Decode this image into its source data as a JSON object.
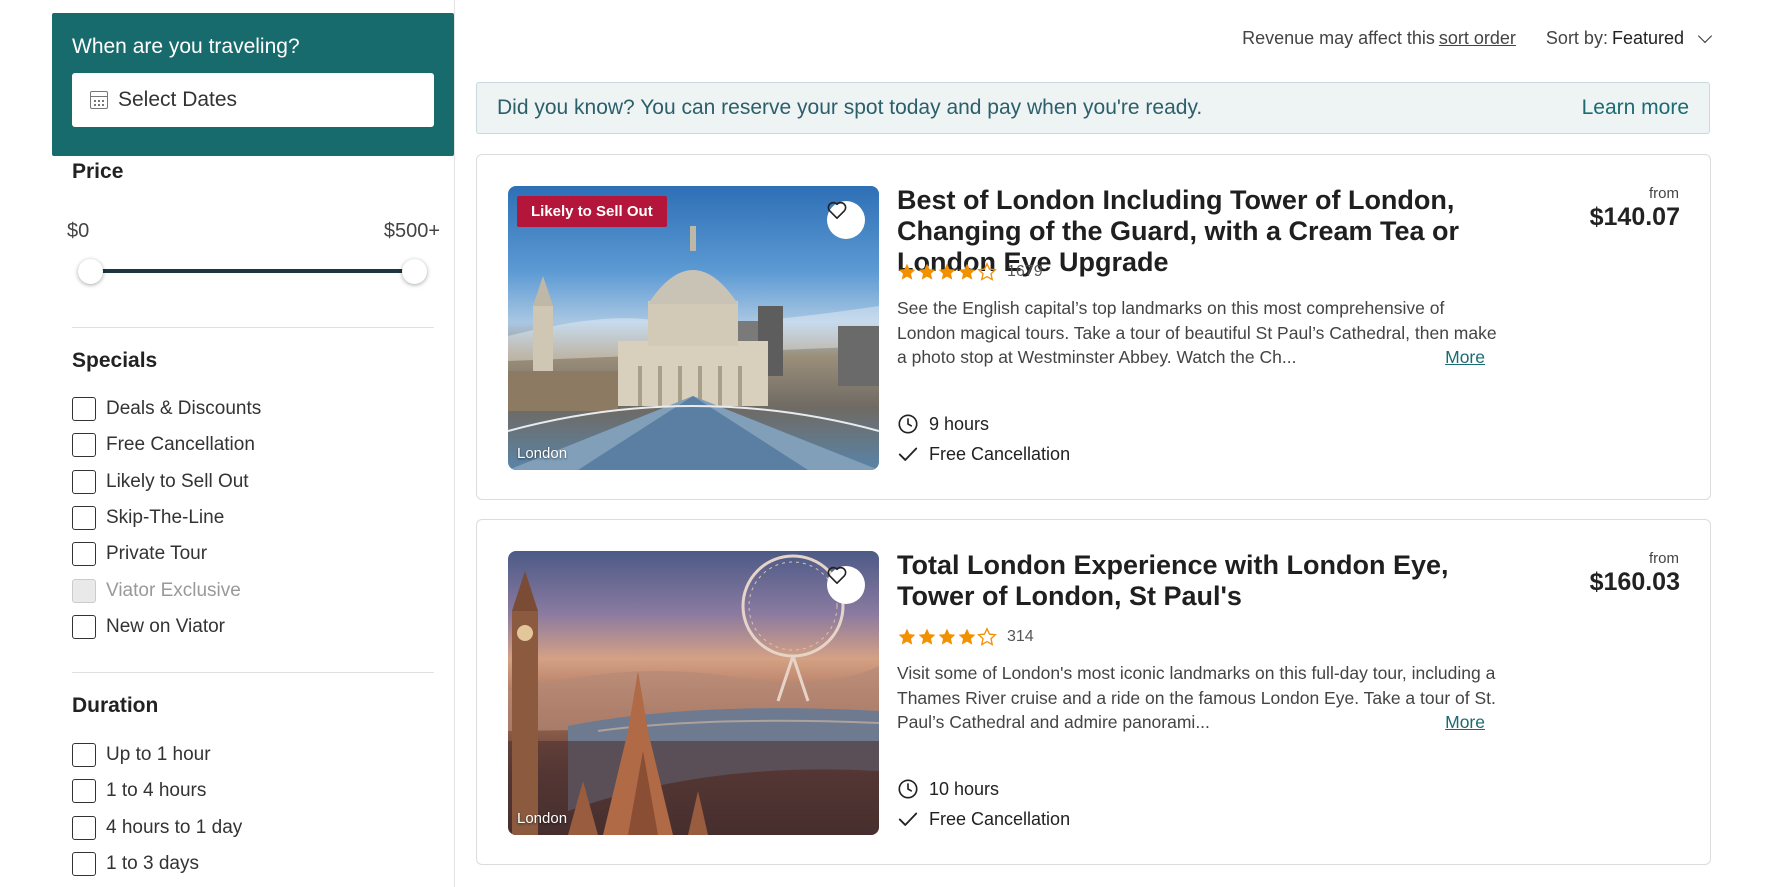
{
  "sidebar": {
    "dates": {
      "title": "When are you traveling?",
      "button_label": "Select Dates"
    },
    "price": {
      "title": "Price",
      "min_label": "$0",
      "max_label": "$500+"
    },
    "specials": {
      "title": "Specials",
      "items": [
        "Deals & Discounts",
        "Free Cancellation",
        "Likely to Sell Out",
        "Skip-The-Line",
        "Private Tour",
        "Viator Exclusive",
        "New on Viator"
      ]
    },
    "duration": {
      "title": "Duration",
      "items": [
        "Up to 1 hour",
        "1 to 4 hours",
        "4 hours to 1 day",
        "1 to 3 days"
      ]
    }
  },
  "topbar": {
    "revenue_text": "Revenue may affect this",
    "sort_order_link": "sort order",
    "sort_label": "Sort by:",
    "sort_value": "Featured"
  },
  "banner": {
    "message": "Did you know?  You can reserve your spot today and pay when you're ready.",
    "link": "Learn more"
  },
  "results": [
    {
      "badge": "Likely to Sell Out",
      "location": "London",
      "title": "Best of London Including Tower of London, Changing of the Guard, with a Cream Tea or London Eye Upgrade",
      "rating": 4,
      "review_count": "1679",
      "description": "See the English capital’s top landmarks on this most comprehensive of London magical tours. Take a tour of beautiful St Paul’s Cathedral, then make a photo stop at Westminster Abbey. Watch the Ch...",
      "more": "More",
      "duration": "9 hours",
      "cancellation": "Free Cancellation",
      "from_label": "from",
      "price": "$140.07"
    },
    {
      "location": "London",
      "title": "Total London Experience with London Eye, Tower of London, St Paul's",
      "rating": 4,
      "review_count": "314",
      "description": "Visit some of London's most iconic landmarks on this full-day tour, including a Thames River cruise and a ride on the famous London Eye. Take a tour of St. Paul’s Cathedral and admire panorami...",
      "more": "More",
      "duration": "10 hours",
      "cancellation": "Free Cancellation",
      "from_label": "from",
      "price": "$160.03"
    }
  ],
  "colors": {
    "brand_teal": "#186b6d",
    "badge_red": "#b4163b",
    "star_orange": "#f29100",
    "link_teal": "#1a6b72"
  },
  "icons": [
    "calendar-icon",
    "chevron-down-icon",
    "heart-icon",
    "star-icon",
    "clock-icon",
    "check-icon"
  ]
}
